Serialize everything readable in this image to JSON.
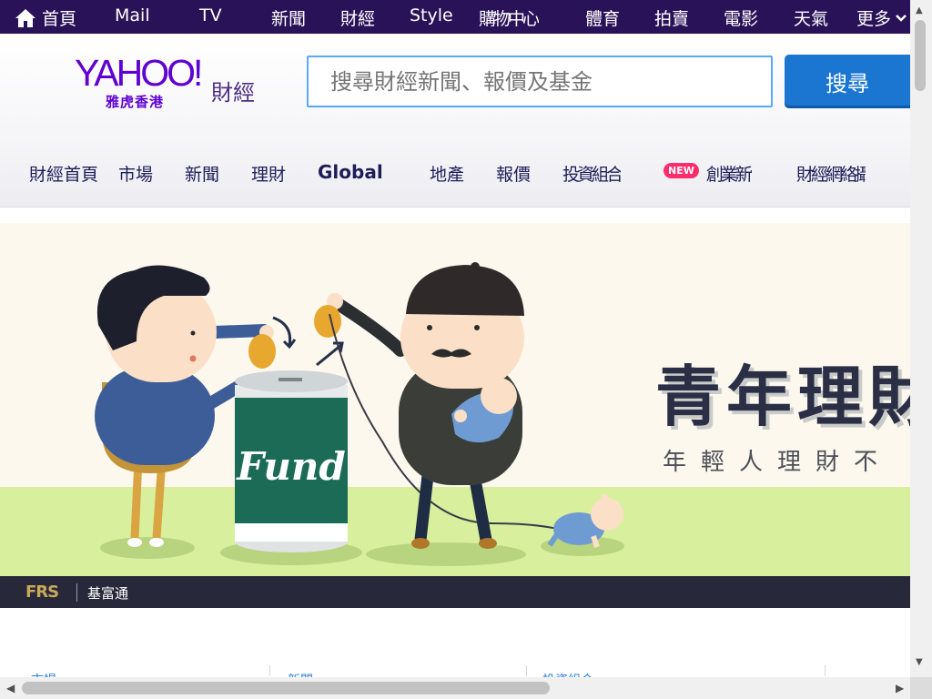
{
  "topbar": {
    "home_label": "首頁",
    "items": [
      "Mail",
      "TV",
      "新聞",
      "財經",
      "Style",
      "購物中心",
      "體育",
      "拍賣",
      "電影",
      "天氣",
      "更多"
    ]
  },
  "header": {
    "logo_text": "YAHOO!",
    "logo_section": "財經",
    "logo_region": "雅虎香港",
    "search_placeholder": "搜尋財經新聞、報價及基金",
    "search_button": "搜尋"
  },
  "nav": {
    "items": [
      "財經首頁",
      "市場",
      "新聞",
      "理財",
      "Global",
      "地產",
      "報價",
      "投資組合",
      "創業新世代",
      "財經網絡攝錄"
    ],
    "new_badge": "NEW"
  },
  "banner": {
    "headline": "青年理財",
    "subline": "年輕人理財不",
    "fund_label": "Fund",
    "sponsor_logo": "FRS",
    "sponsor_name": "基富通"
  },
  "cards": {
    "titles": [
      "市場",
      "新聞",
      "投資組合"
    ]
  },
  "colors": {
    "topbar_bg": "#2a1258",
    "brand_purple": "#5f01d1",
    "search_border": "#59a9f7",
    "search_button": "#1a76d1",
    "new_badge": "#ff2c6b",
    "banner_bg": "#fcf8ee",
    "banner_footer": "#27293b"
  },
  "icons": {
    "home": "home-icon",
    "more_chevron": "chevron-down-icon"
  }
}
